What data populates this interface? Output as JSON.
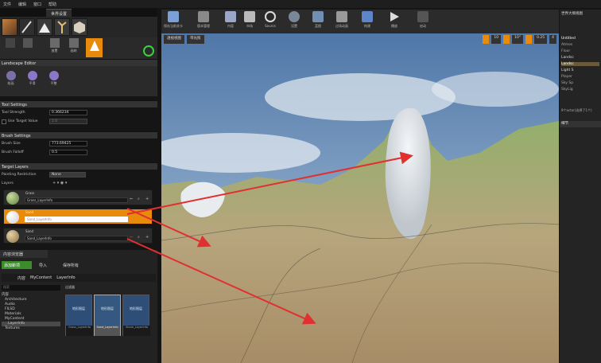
{
  "menu": [
    "文件",
    "编辑",
    "窗口",
    "帮助"
  ],
  "window_tab": "世界设置",
  "modes": {
    "place": "放置",
    "paint": "画刷"
  },
  "landscape_editor": {
    "title": "Landscape Editor",
    "tools": [
      "绘画",
      "平滑",
      "平整"
    ],
    "tool_settings": {
      "title": "Tool Settings",
      "strength_label": "Tool Strength",
      "strength_value": "0.366234",
      "use_target_label": "Use Target Value",
      "use_target_value": "1.0"
    },
    "brush_settings": {
      "title": "Brush Settings",
      "size_label": "Brush Size",
      "size_value": "773.69425",
      "falloff_label": "Brush Falloff",
      "falloff_value": "0.5"
    },
    "target_layers": {
      "title": "Target Layers",
      "painting_label": "Painting Restriction",
      "painting_value": "None",
      "layers_label": "Layers",
      "items": [
        {
          "name": "Grass",
          "info": "Grass_LayerInfo",
          "selected": false,
          "color": "#7fa050"
        },
        {
          "name": "Sand",
          "info": "Sand_LayerInfo",
          "selected": true,
          "color": "#e4e4e4"
        },
        {
          "name": "Sand",
          "info": "Sand_LayerInfo",
          "selected": false,
          "color": "#b59a6b"
        }
      ]
    }
  },
  "content_browser": {
    "tab": "内容浏览器",
    "add_button": "添加新项",
    "import_button": "导入",
    "save_all_button": "保存所有",
    "path": [
      "内容",
      "MyContent",
      "LayerInfo"
    ],
    "filter_label": "过滤器",
    "search_placeholder": "搜索",
    "tree": [
      "内容",
      "Architecture",
      "Audio",
      "FILSD",
      "Materials",
      "MyContent",
      "LayerInfo",
      "Textures"
    ],
    "assets": [
      {
        "label": "地形图层",
        "name": "Grass_LayerInfo"
      },
      {
        "label": "地形图层",
        "name": "Sand_LayerInfo"
      },
      {
        "label": "地形图层",
        "name": "Stone_LayerInfo"
      }
    ]
  },
  "toolbar": [
    "保存当前关卡",
    "版本管理",
    "内容",
    "市场",
    "Source",
    "设置",
    "蓝图",
    "过场动画",
    "构建",
    "播放",
    "启动"
  ],
  "viewport": {
    "perspective": "透视视图",
    "lit": "带光照",
    "grid_value": "10",
    "angle_value": "10°",
    "scale_value": "0.25",
    "cam_speed": "4"
  },
  "outliner": {
    "title": "世界大纲视图",
    "items": [
      "Untitled",
      "Atmos",
      "Floor",
      "Landsc",
      "Landsc",
      "Light S",
      "Player",
      "Sky Sp",
      "SkyLig"
    ],
    "count": "9个actor(选择了1个)"
  },
  "details": {
    "title": "细节"
  },
  "colors": {
    "accent": "#e88a0c",
    "arrow": "#e03030"
  }
}
